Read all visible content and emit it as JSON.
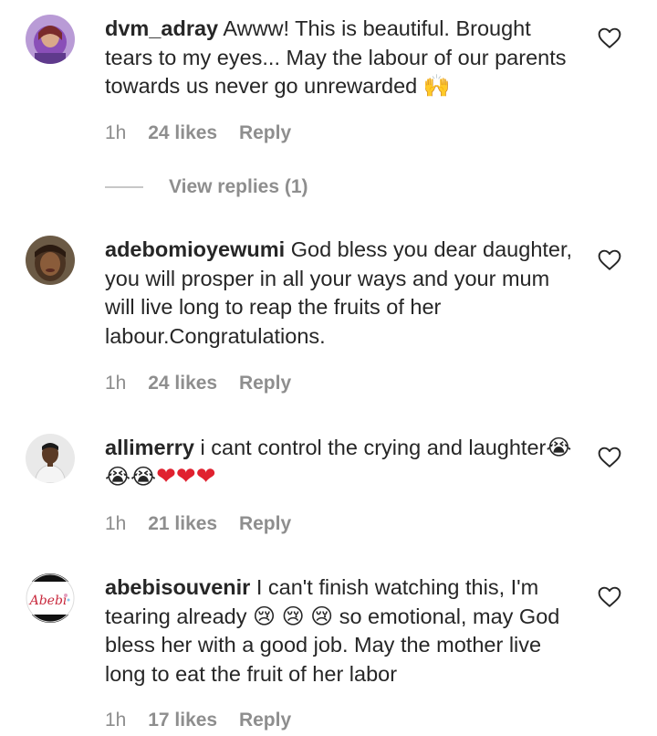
{
  "comments": [
    {
      "username": "dvm_adray",
      "text": "Awww! This is beautiful. Brought tears to my eyes... May the labour of our parents towards us never go unrewarded",
      "emoji": "🙌",
      "time": "1h",
      "likes": "24 likes",
      "reply": "Reply",
      "view_replies": "View replies (1)"
    },
    {
      "username": "adebomioyewumi",
      "text": "God bless you dear daughter, you will prosper in all your ways and your mum will live long to reap the fruits of her labour.Congratulations.",
      "time": "1h",
      "likes": "24 likes",
      "reply": "Reply"
    },
    {
      "username": "allimerry",
      "text": "i cant control the crying and laughter",
      "emojis": [
        "😭",
        "😭",
        "😭",
        "❤",
        "❤",
        "❤"
      ],
      "time": "1h",
      "likes": "21 likes",
      "reply": "Reply"
    },
    {
      "username": "abebisouvenir",
      "text_a": "I can't finish watching this, I'm tearing already",
      "emojis": [
        "😢",
        "😢",
        "😢"
      ],
      "text_b": "so emotional, may God bless her with a good job. May the mother live long to eat the fruit of her labor",
      "avatar_logo": "Abebi",
      "time": "1h",
      "likes": "17 likes",
      "reply": "Reply"
    }
  ],
  "colors": {
    "text": "#262626",
    "meta": "#8e8e8e",
    "heart": "#e0212f"
  },
  "icons": {
    "like": "heart-outline-icon"
  }
}
